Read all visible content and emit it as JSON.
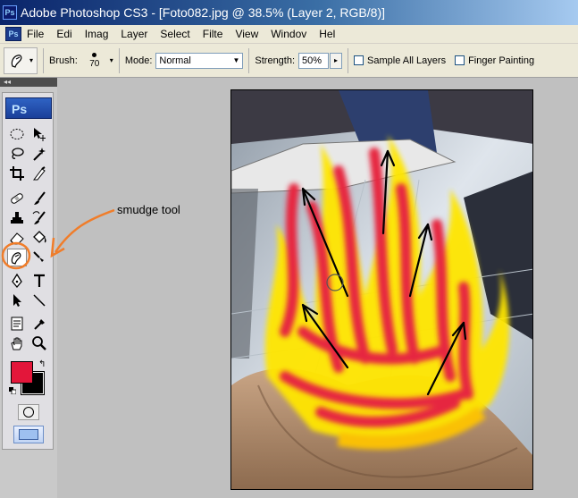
{
  "window": {
    "title": "Adobe Photoshop CS3 - [Foto082.jpg @ 38.5% (Layer 2, RGB/8)]",
    "app_icon": "Ps"
  },
  "menu": {
    "items": [
      "File",
      "Edi",
      "Imag",
      "Layer",
      "Select",
      "Filte",
      "View",
      "Windov",
      "Hel"
    ]
  },
  "options": {
    "brush_label": "Brush:",
    "brush_size": "70",
    "mode_label": "Mode:",
    "mode_value": "Normal",
    "strength_label": "Strength:",
    "strength_value": "50%",
    "sample_all_layers_label": "Sample All Layers",
    "finger_painting_label": "Finger Painting",
    "arrow": "▸"
  },
  "toolbox": {
    "logo": "Ps",
    "header": "◂◂",
    "foreground_color": "#e3163a",
    "background_color": "#000000",
    "swap_icon": "↰"
  },
  "annotation": {
    "label": "smudge tool",
    "color": "#f07d2a"
  },
  "document": {
    "flame_colors": [
      "#e62840",
      "#ffe600",
      "#ffc400"
    ],
    "arrow_color": "#000000"
  }
}
